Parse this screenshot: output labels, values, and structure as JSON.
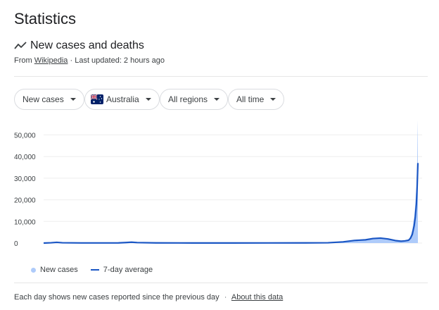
{
  "page": {
    "title": "Statistics"
  },
  "section": {
    "title": "New cases and deaths",
    "source_prefix": "From",
    "source_link": "Wikipedia",
    "updated": "· Last updated: 2 hours ago",
    "icon": "trending-line-icon"
  },
  "filters": {
    "metric": "New cases",
    "country": "Australia",
    "region": "All regions",
    "period": "All time"
  },
  "colors": {
    "bars": "#aecbfa",
    "line": "#1a56c4",
    "grid": "#eeeeee",
    "text": "#3c4043"
  },
  "legend": {
    "new_cases": "New cases",
    "avg": "7-day average"
  },
  "footer": {
    "note": "Each day shows new cases reported since the previous day",
    "sep": "·",
    "link": "About this data"
  },
  "chart_data": {
    "type": "area",
    "ylim": [
      0,
      57000
    ],
    "yticks": [
      "0",
      "10,000",
      "20,000",
      "30,000",
      "40,000",
      "50,000"
    ],
    "ytick_values": [
      0,
      10000,
      20000,
      30000,
      40000,
      50000
    ],
    "grid": true,
    "legend_position": "bottom-left",
    "series": [
      {
        "name": "New cases",
        "style": "bars",
        "points": [
          [
            0,
            0
          ],
          [
            0.02,
            200
          ],
          [
            0.035,
            400
          ],
          [
            0.05,
            150
          ],
          [
            0.1,
            80
          ],
          [
            0.15,
            60
          ],
          [
            0.2,
            100
          ],
          [
            0.22,
            300
          ],
          [
            0.235,
            500
          ],
          [
            0.25,
            250
          ],
          [
            0.3,
            80
          ],
          [
            0.4,
            50
          ],
          [
            0.5,
            40
          ],
          [
            0.6,
            60
          ],
          [
            0.7,
            80
          ],
          [
            0.76,
            150
          ],
          [
            0.8,
            600
          ],
          [
            0.83,
            1300
          ],
          [
            0.86,
            1600
          ],
          [
            0.88,
            2200
          ],
          [
            0.9,
            2500
          ],
          [
            0.92,
            2000
          ],
          [
            0.94,
            1200
          ],
          [
            0.955,
            900
          ],
          [
            0.965,
            1100
          ],
          [
            0.975,
            1500
          ],
          [
            0.98,
            3000
          ],
          [
            0.985,
            6000
          ],
          [
            0.99,
            12000
          ],
          [
            0.993,
            18000
          ],
          [
            0.996,
            26000
          ],
          [
            0.998,
            36000
          ],
          [
            0.9995,
            57000
          ],
          [
            1,
            48000
          ]
        ]
      },
      {
        "name": "7-day average",
        "style": "line",
        "points": [
          [
            0,
            0
          ],
          [
            0.02,
            150
          ],
          [
            0.035,
            350
          ],
          [
            0.05,
            150
          ],
          [
            0.1,
            70
          ],
          [
            0.15,
            60
          ],
          [
            0.2,
            90
          ],
          [
            0.22,
            250
          ],
          [
            0.235,
            400
          ],
          [
            0.25,
            220
          ],
          [
            0.3,
            80
          ],
          [
            0.4,
            50
          ],
          [
            0.5,
            40
          ],
          [
            0.6,
            60
          ],
          [
            0.7,
            80
          ],
          [
            0.76,
            150
          ],
          [
            0.8,
            550
          ],
          [
            0.83,
            1200
          ],
          [
            0.86,
            1500
          ],
          [
            0.88,
            2100
          ],
          [
            0.9,
            2300
          ],
          [
            0.92,
            1900
          ],
          [
            0.94,
            1150
          ],
          [
            0.955,
            850
          ],
          [
            0.965,
            1000
          ],
          [
            0.975,
            1300
          ],
          [
            0.98,
            2200
          ],
          [
            0.985,
            4000
          ],
          [
            0.99,
            8000
          ],
          [
            0.993,
            12000
          ],
          [
            0.996,
            18000
          ],
          [
            0.998,
            26000
          ],
          [
            1,
            37000
          ]
        ]
      }
    ]
  }
}
